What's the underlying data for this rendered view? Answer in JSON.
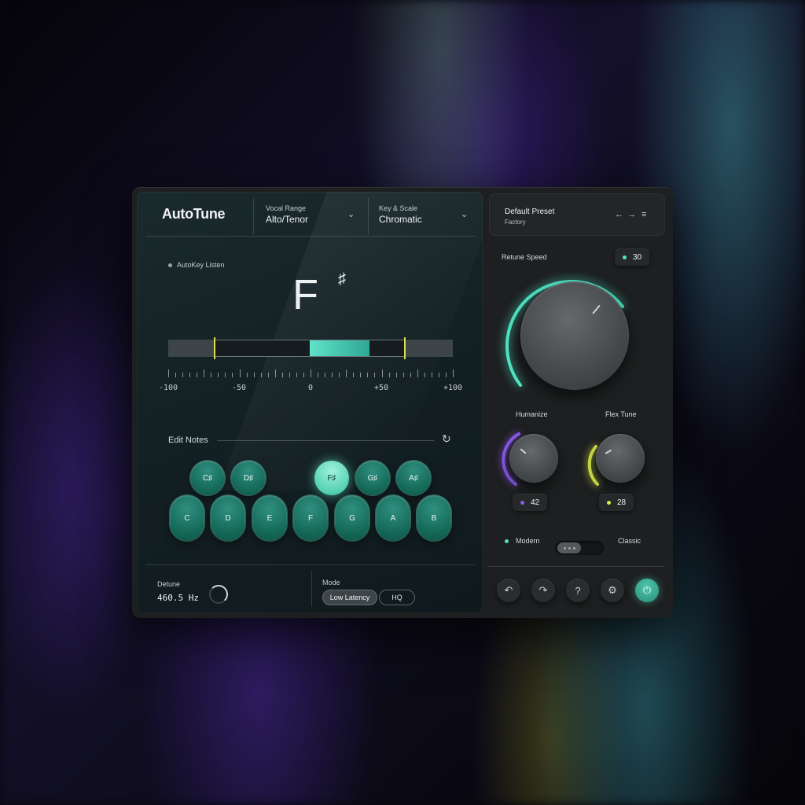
{
  "app": {
    "logo": "AutoTune"
  },
  "header": {
    "vocal_range": {
      "label": "Vocal Range",
      "value": "Alto/Tenor"
    },
    "key_scale": {
      "label": "Key & Scale",
      "value": "Chromatic"
    }
  },
  "pitch": {
    "autokey_label": "AutoKey Listen",
    "note": "F",
    "accidental": "♯",
    "meter_ticks": [
      "-100",
      "-50",
      "0",
      "+50",
      "+100"
    ]
  },
  "edit_notes": {
    "label": "Edit Notes",
    "sharps": [
      "C♯",
      "D♯",
      "F♯",
      "G♯",
      "A♯"
    ],
    "naturals": [
      "C",
      "D",
      "E",
      "F",
      "G",
      "A",
      "B"
    ],
    "active_key": "F♯"
  },
  "footer": {
    "detune_label": "Detune",
    "detune_value": "460.5 Hz",
    "mode_label": "Mode",
    "mode_options": [
      "Low Latency",
      "HQ"
    ],
    "mode_selected": "Low Latency"
  },
  "preset": {
    "name": "Default Preset",
    "bank": "Factory"
  },
  "controls": {
    "retune_speed": {
      "label": "Retune Speed",
      "value": "30"
    },
    "humanize": {
      "label": "Humanize",
      "value": "42"
    },
    "flex_tune": {
      "label": "Flex Tune",
      "value": "28"
    },
    "mode_toggle": {
      "left": "Modern",
      "right": "Classic",
      "selected": "Modern"
    }
  },
  "colors": {
    "accent_teal": "#4fe3c4",
    "humanize_purple": "#8c5cf0",
    "flex_yellow": "#d9e84a",
    "meter_marker": "#d7e04a"
  },
  "icons": [
    "undo-icon",
    "redo-icon",
    "help-icon",
    "settings-icon",
    "power-icon",
    "chevron-down-icon",
    "arrow-left-icon",
    "arrow-right-icon",
    "menu-icon",
    "reset-icon"
  ]
}
